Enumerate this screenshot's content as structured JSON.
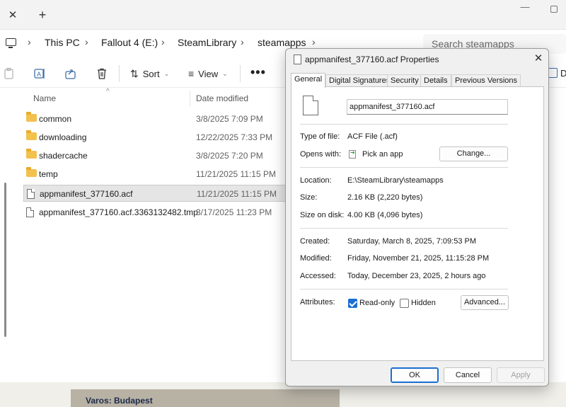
{
  "explorer": {
    "breadcrumb": [
      "This PC",
      "Fallout 4 (E:)",
      "SteamLibrary",
      "steamapps"
    ],
    "search_placeholder": "Search steamapps",
    "toolbar": {
      "sort_label": "Sort",
      "view_label": "View",
      "more_label": "•••",
      "right_label": "D"
    },
    "columns": {
      "name": "Name",
      "date": "Date modified"
    },
    "rows": [
      {
        "name": "common",
        "date": "3/8/2025 7:09 PM",
        "type": "folder",
        "selected": false
      },
      {
        "name": "downloading",
        "date": "12/22/2025 7:33 PM",
        "type": "folder",
        "selected": false
      },
      {
        "name": "shadercache",
        "date": "3/8/2025 7:20 PM",
        "type": "folder",
        "selected": false
      },
      {
        "name": "temp",
        "date": "11/21/2025 11:15 PM",
        "type": "folder",
        "selected": false
      },
      {
        "name": "appmanifest_377160.acf",
        "date": "11/21/2025 11:15 PM",
        "type": "file",
        "selected": true
      },
      {
        "name": "appmanifest_377160.acf.3363132482.tmp",
        "date": "3/17/2025 11:23 PM",
        "type": "file",
        "selected": false
      }
    ]
  },
  "background_window": {
    "text": "Varos: Budapest"
  },
  "dialog": {
    "title": "appmanifest_377160.acf Properties",
    "tabs": [
      "General",
      "Digital Signatures",
      "Security",
      "Details",
      "Previous Versions"
    ],
    "active_tab": "General",
    "filename": "appmanifest_377160.acf",
    "type_label": "Type of file:",
    "type_value": "ACF File (.acf)",
    "opens_label": "Opens with:",
    "opens_value": "Pick an app",
    "change_button": "Change...",
    "location_label": "Location:",
    "location_value": "E:\\SteamLibrary\\steamapps",
    "size_label": "Size:",
    "size_value": "2.16 KB (2,220 bytes)",
    "size_on_disk_label": "Size on disk:",
    "size_on_disk_value": "4.00 KB (4,096 bytes)",
    "created_label": "Created:",
    "created_value": "Saturday, March 8, 2025, 7:09:53 PM",
    "modified_label": "Modified:",
    "modified_value": "Friday, November 21, 2025, 11:15:28 PM",
    "accessed_label": "Accessed:",
    "accessed_value": "Today, December 23, 2025, 2 hours ago",
    "attributes_label": "Attributes:",
    "readonly_label": "Read-only",
    "readonly_checked": true,
    "hidden_label": "Hidden",
    "hidden_checked": false,
    "advanced_button": "Advanced...",
    "ok_button": "OK",
    "cancel_button": "Cancel",
    "apply_button": "Apply"
  },
  "colors": {
    "accent": "#1a6fd1",
    "folder": "#f2c14e",
    "selection": "#e5e5e5"
  }
}
